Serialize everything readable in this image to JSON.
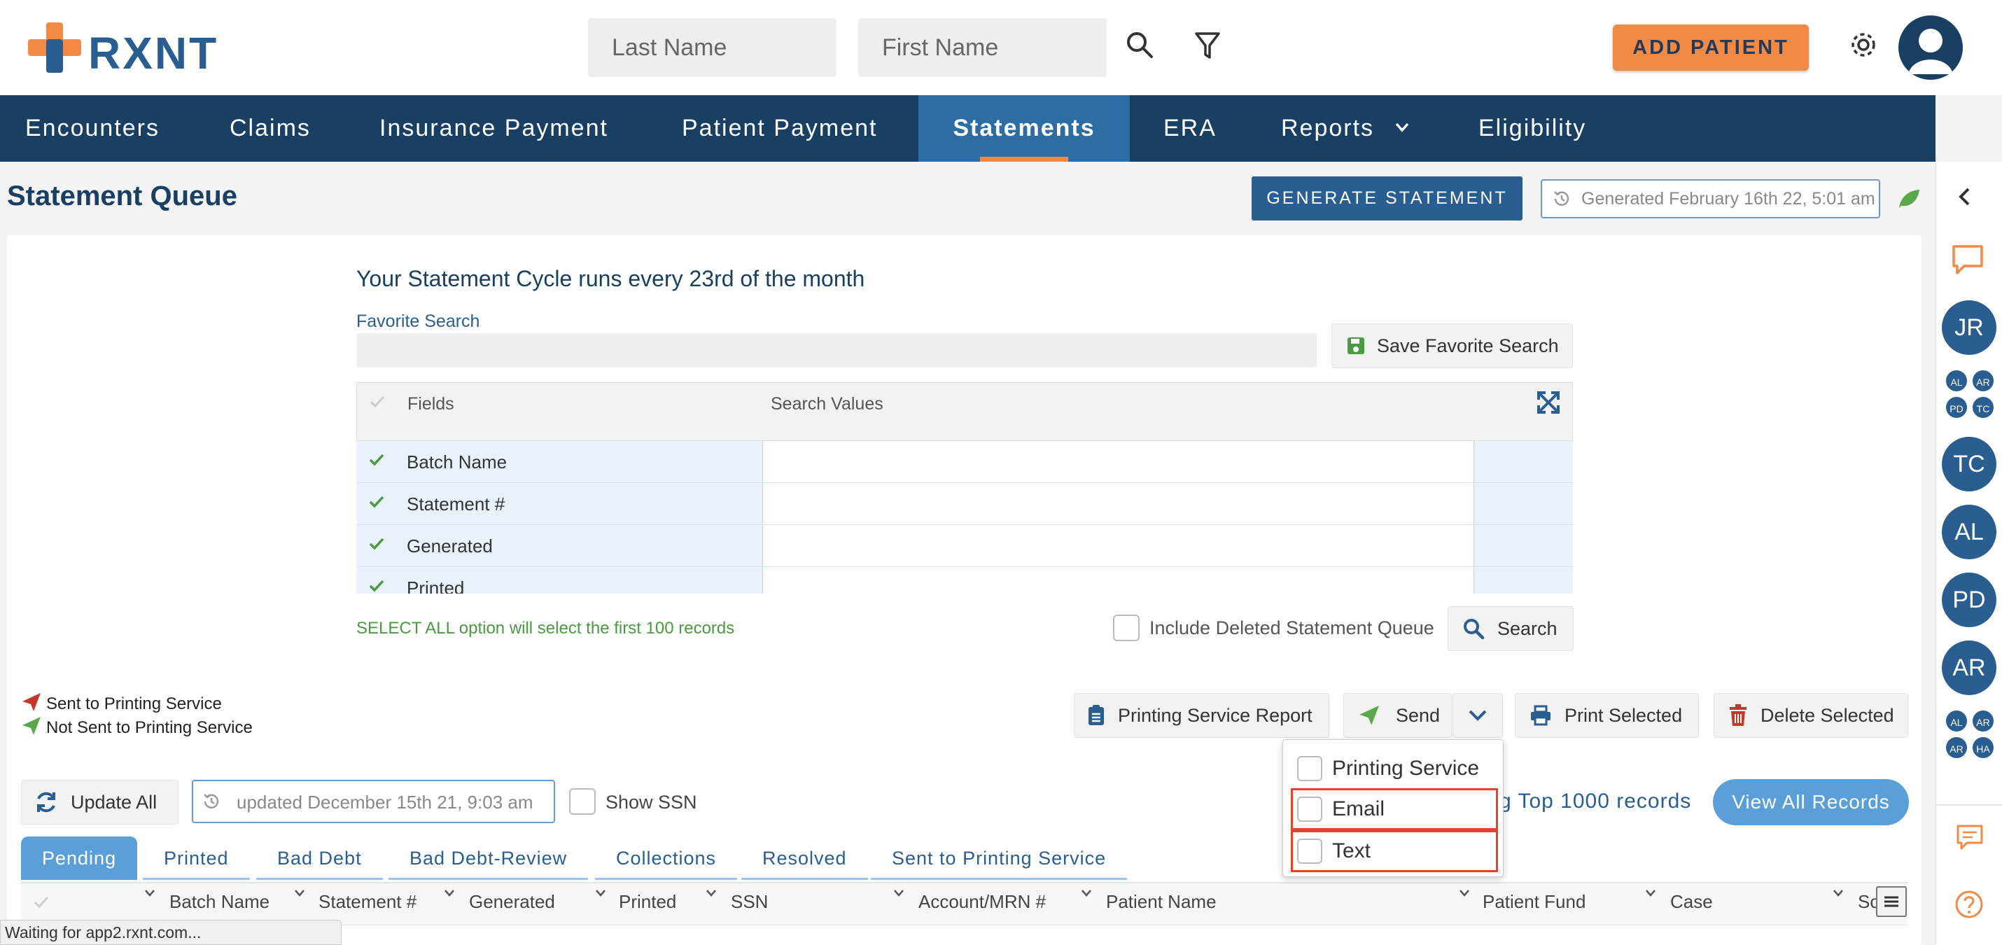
{
  "header": {
    "logo_text": "RXNT",
    "last_name_placeholder": "Last Name",
    "first_name_placeholder": "First Name",
    "add_patient_label": "ADD PATIENT"
  },
  "nav": {
    "items": [
      {
        "label": "Encounters"
      },
      {
        "label": "Claims"
      },
      {
        "label": "Insurance Payment"
      },
      {
        "label": "Patient Payment"
      },
      {
        "label": "Statements",
        "active": true
      },
      {
        "label": "ERA"
      },
      {
        "label": "Reports"
      },
      {
        "label": "Eligibility"
      }
    ]
  },
  "page": {
    "title": "Statement Queue",
    "generate_button": "GENERATE STATEMENT",
    "generated_stamp": "Generated February 16th 22, 5:01 am"
  },
  "search": {
    "cycle_text": "Your Statement Cycle runs every 23rd of the month",
    "favorite_label": "Favorite Search",
    "save_favorite_label": "Save Favorite Search",
    "grid_header_fields": "Fields",
    "grid_header_values": "Search Values",
    "rows": [
      {
        "field": "Batch Name"
      },
      {
        "field": "Statement #"
      },
      {
        "field": "Generated"
      },
      {
        "field": "Printed"
      }
    ],
    "select_all_note": "SELECT ALL option will select the first 100 records",
    "include_deleted_label": "Include Deleted Statement Queue",
    "search_button": "Search"
  },
  "legend": {
    "sent": "Sent to Printing Service",
    "not_sent": "Not Sent to Printing Service"
  },
  "actions": {
    "printing_report": "Printing Service Report",
    "send": "Send",
    "print_selected": "Print Selected",
    "delete_selected": "Delete Selected",
    "update_all": "Update All",
    "updated_stamp": "updated December 15th 21, 9:03 am",
    "show_ssn": "Show SSN",
    "top_records_note": "g Top 1000 records",
    "view_all": "View All Records"
  },
  "send_dropdown": {
    "items": [
      {
        "label": "Printing Service",
        "highlighted": false
      },
      {
        "label": "Email",
        "highlighted": true
      },
      {
        "label": "Text",
        "highlighted": true
      }
    ]
  },
  "tabs": [
    {
      "label": "Pending",
      "active": true
    },
    {
      "label": "Printed"
    },
    {
      "label": "Bad Debt"
    },
    {
      "label": "Bad Debt-Review"
    },
    {
      "label": "Collections"
    },
    {
      "label": "Resolved"
    },
    {
      "label": "Sent to Printing Service"
    }
  ],
  "columns": [
    "Batch Name",
    "Statement #",
    "Generated",
    "Printed",
    "SSN",
    "Account/MRN #",
    "Patient Name",
    "Patient Fund",
    "Case",
    "Sc"
  ],
  "rail": {
    "avatars": [
      "JR",
      "TC",
      "AL",
      "PD",
      "AR"
    ],
    "group1": [
      "AL",
      "AR",
      "PD",
      "TC"
    ],
    "group2": [
      "AL",
      "AR",
      "AR",
      "HA"
    ]
  },
  "status_bar": "Waiting for app2.rxnt.com...",
  "colors": {
    "brand_navy": "#193f63",
    "active_tab": "#2e6da4",
    "accent_orange": "#f28a46",
    "highlight_red": "#e0452b"
  }
}
